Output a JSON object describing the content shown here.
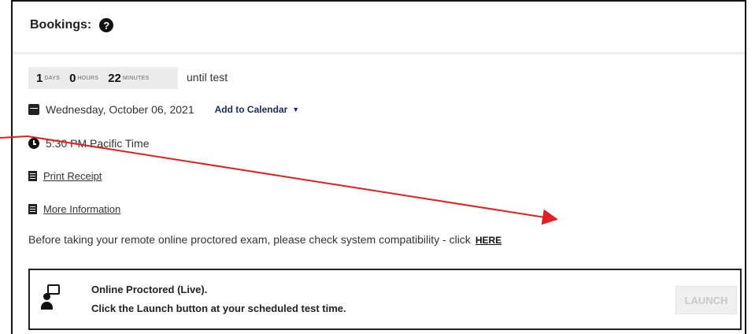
{
  "header": {
    "title": "Bookings:",
    "help_icon": "question-circle-icon"
  },
  "countdown": {
    "days_value": "1",
    "days_unit": "DAYS",
    "hours_value": "0",
    "hours_unit": "HOURS",
    "minutes_value": "22",
    "minutes_unit": "MINUTES",
    "suffix": "until test"
  },
  "date_row": {
    "icon": "calendar-icon",
    "date": "Wednesday, October 06, 2021",
    "add_calendar_label": "Add to Calendar"
  },
  "time_row": {
    "icon": "clock-icon",
    "time": "5:30 PM  Pacific Time"
  },
  "receipt_row": {
    "icon": "document-icon",
    "label": "Print Receipt"
  },
  "info_row": {
    "icon": "document-icon",
    "label": "More Information"
  },
  "compat": {
    "text": "Before taking your remote online proctored exam, please check system compatibility - click",
    "link_label": "HERE"
  },
  "proctor": {
    "icon": "remote-proctor-icon",
    "line1": "Online Proctored (Live).",
    "line2": "Click the Launch button at your scheduled test time.",
    "launch_label": "LAUNCH"
  },
  "annotation": {
    "arrow_color": "#e02020"
  }
}
